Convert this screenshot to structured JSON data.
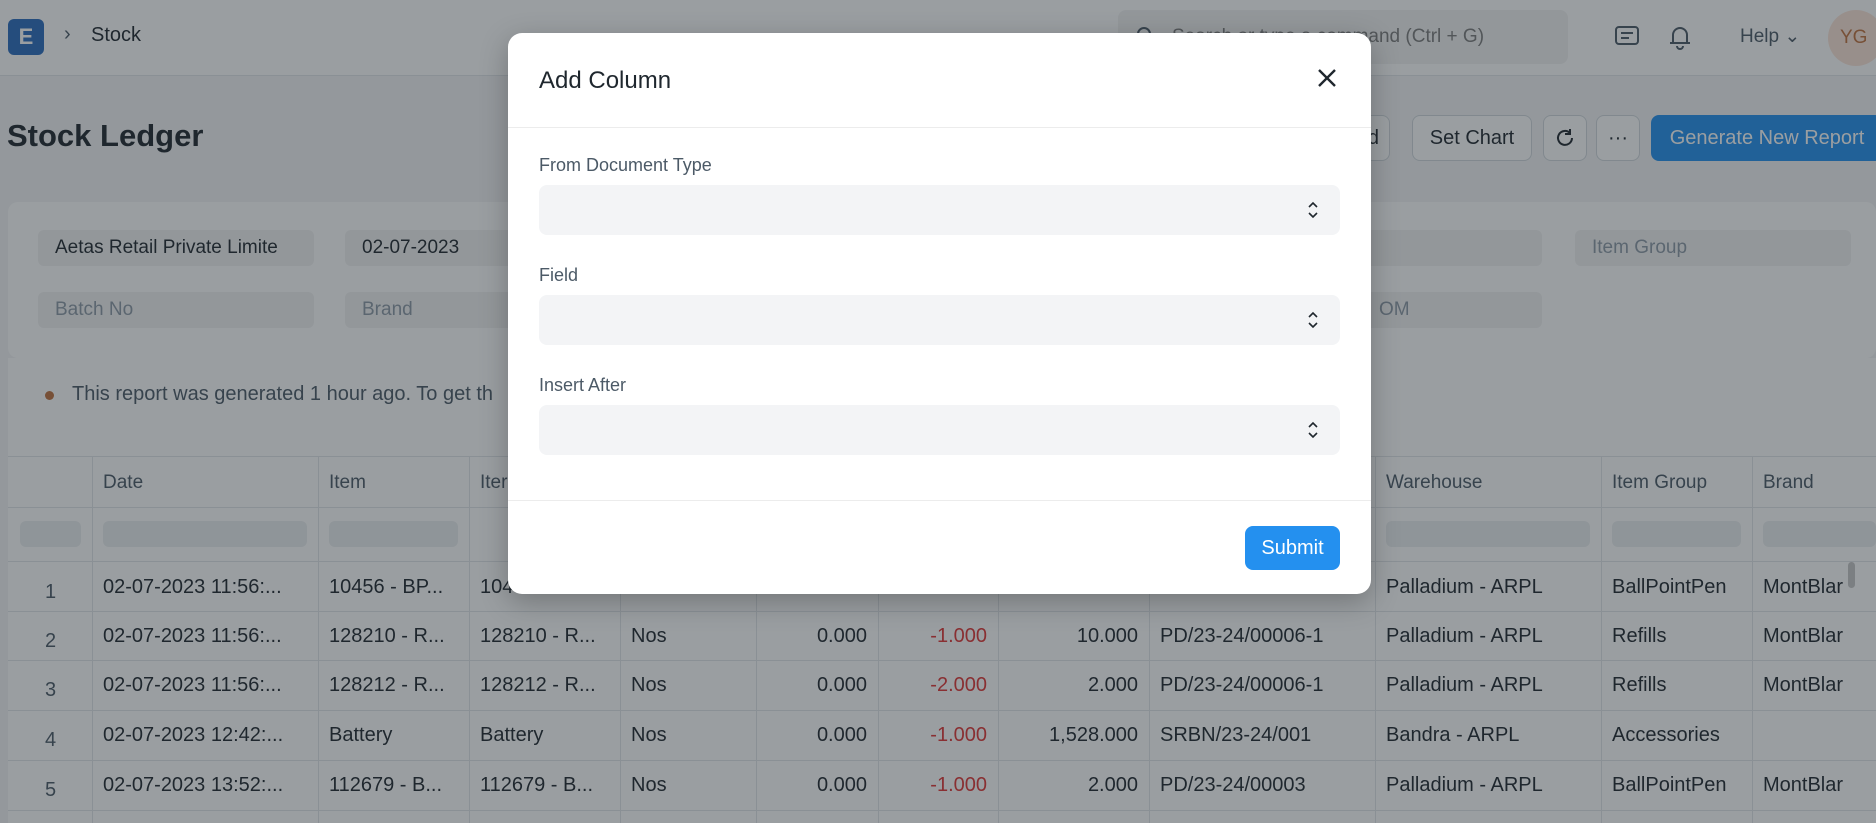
{
  "navbar": {
    "logo_letter": "E",
    "breadcrumb": "Stock",
    "search_placeholder": "Search or type a command (Ctrl + G)",
    "help_label": "Help",
    "avatar_initials": "YG"
  },
  "page": {
    "title": "Stock Ledger",
    "buttons": {
      "prev_label": "d",
      "set_chart": "Set Chart",
      "more": "···",
      "generate": "Generate New Report"
    }
  },
  "filters": {
    "company": "Aetas Retail Private Limite",
    "from_date": "02-07-2023",
    "item_group": "Item Group",
    "batch_no": "Batch No",
    "brand": "Brand",
    "uom_partial": "OM"
  },
  "message": "This report was generated 1 hour ago. To get th",
  "table": {
    "headers": [
      "Date",
      "Item",
      "Iter",
      "Warehouse",
      "Item Group",
      "Brand"
    ],
    "rows": [
      {
        "idx": "1",
        "date": "02-07-2023 11:56:...",
        "item": "10456 - BP...",
        "item2": "104",
        "uom": "",
        "qty": "",
        "out": "",
        "bal": "",
        "voucher": "",
        "warehouse": "Palladium - ARPL",
        "group": "BallPointPen",
        "brand": "MontBlar"
      },
      {
        "idx": "2",
        "date": "02-07-2023 11:56:...",
        "item": "128210 - R...",
        "item2": "128210 - R...",
        "uom": "Nos",
        "qty": "0.000",
        "out": "-1.000",
        "bal": "10.000",
        "voucher": "PD/23-24/00006-1",
        "warehouse": "Palladium - ARPL",
        "group": "Refills",
        "brand": "MontBlar"
      },
      {
        "idx": "3",
        "date": "02-07-2023 11:56:...",
        "item": "128212 - R...",
        "item2": "128212 - R...",
        "uom": "Nos",
        "qty": "0.000",
        "out": "-2.000",
        "bal": "2.000",
        "voucher": "PD/23-24/00006-1",
        "warehouse": "Palladium - ARPL",
        "group": "Refills",
        "brand": "MontBlar"
      },
      {
        "idx": "4",
        "date": "02-07-2023 12:42:...",
        "item": "Battery",
        "item2": "Battery",
        "uom": "Nos",
        "qty": "0.000",
        "out": "-1.000",
        "bal": "1,528.000",
        "voucher": "SRBN/23-24/001",
        "warehouse": "Bandra - ARPL",
        "group": "Accessories",
        "brand": ""
      },
      {
        "idx": "5",
        "date": "02-07-2023 13:52:...",
        "item": "112679 - B...",
        "item2": "112679 - B...",
        "uom": "Nos",
        "qty": "0.000",
        "out": "-1.000",
        "bal": "2.000",
        "voucher": "PD/23-24/00003",
        "warehouse": "Palladium - ARPL",
        "group": "BallPointPen",
        "brand": "MontBlar"
      }
    ]
  },
  "modal": {
    "title": "Add Column",
    "fields": [
      {
        "label": "From Document Type",
        "value": ""
      },
      {
        "label": "Field",
        "value": ""
      },
      {
        "label": "Insert After",
        "value": ""
      }
    ],
    "submit_label": "Submit"
  }
}
